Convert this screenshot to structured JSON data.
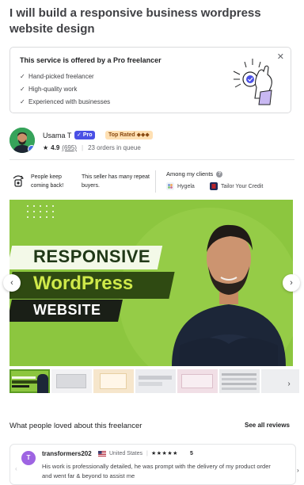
{
  "gig": {
    "title": "I will build a responsive business wordpress website design"
  },
  "pro_box": {
    "heading": "This service is offered by a Pro freelancer",
    "close_icon": "close-icon",
    "items": [
      "Hand-picked freelancer",
      "High-quality work",
      "Experienced with businesses"
    ]
  },
  "seller": {
    "name": "Usama T",
    "pro_badge": "Pro",
    "top_rated_badge": "Top Rated ◆◆◆",
    "rating": "4.9",
    "reviews_count": "(695)",
    "orders_in_queue": "23 orders in queue"
  },
  "highlights": {
    "repeat_title_line1": "People keep",
    "repeat_title_line2": "coming back!",
    "repeat_desc": "This seller has many repeat buyers.",
    "clients_title": "Among my clients",
    "clients": [
      {
        "name": "Hygela",
        "color": "#dfe7f3"
      },
      {
        "name": "Tailor Your Credit",
        "color": "#b8242b"
      }
    ]
  },
  "hero": {
    "line1": "RESPONSIVE",
    "line2": "WordPress",
    "line3": "WEBSITE",
    "bg_color": "#8cc63f"
  },
  "gallery": {
    "thumbs": [
      {
        "kind": "hero",
        "color": "#8cc63f"
      },
      {
        "kind": "site",
        "color": "#eeeef0"
      },
      {
        "kind": "site",
        "color": "#f4e2c8"
      },
      {
        "kind": "site",
        "color": "#e6e7ea"
      },
      {
        "kind": "site",
        "color": "#f1dfe6"
      },
      {
        "kind": "site",
        "color": "#e4e5e7"
      },
      {
        "kind": "site",
        "color": "#e9eaec"
      }
    ]
  },
  "reviews_section": {
    "title": "What people loved about this freelancer",
    "see_all": "See all reviews"
  },
  "review": {
    "avatar_letter": "T",
    "name": "transformers202",
    "country": "United States",
    "stars": "★★★★★",
    "score": "5",
    "text": "His work is professionally detailed, he was prompt with the delivery of my product order and went far & beyond to assist me"
  }
}
